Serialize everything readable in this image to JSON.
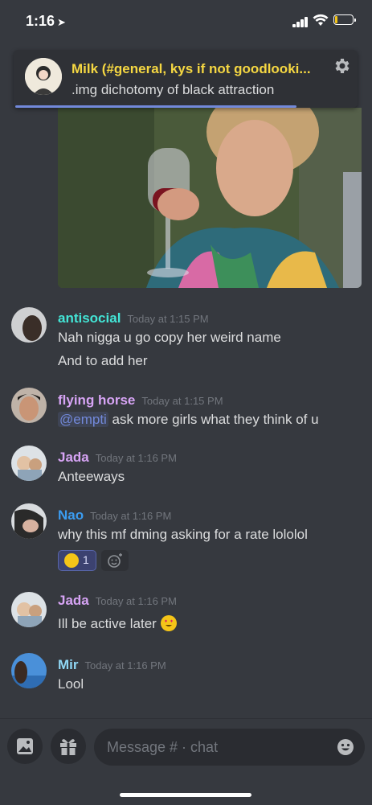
{
  "status_bar": {
    "time": "1:16"
  },
  "notification": {
    "title": "Milk (#general, kys if not goodlooki...",
    "body": ".img dichotomy of black attraction"
  },
  "messages": [
    {
      "author": "antisocial",
      "color": "#43e5d6",
      "time": "Today at 1:15 PM",
      "lines": [
        "Nah nigga u go copy her weird name",
        "And to add her"
      ]
    },
    {
      "author": "flying horse",
      "color": "#d7a4f5",
      "time": "Today at 1:15 PM",
      "mention": "@empti",
      "text": " ask more girls what they think of u"
    },
    {
      "author": "Jada",
      "color": "#d7a4f5",
      "time": "Today at 1:16 PM",
      "lines": [
        "Anteeways"
      ]
    },
    {
      "author": "Nao",
      "color": "#3b9cf0",
      "time": "Today at 1:16 PM",
      "lines": [
        "why this mf dming asking for a rate lololol"
      ],
      "reaction": {
        "emoji": "joy-emoji",
        "count": "1"
      }
    },
    {
      "author": "Jada",
      "color": "#d7a4f5",
      "time": "Today at 1:16 PM",
      "lines": [
        "Ill be active later"
      ],
      "emoji": "heart-eyes-emoji"
    },
    {
      "author": "Mir",
      "color": "#8fd5f2",
      "time": "Today at 1:16 PM",
      "lines": [
        "Lool"
      ]
    }
  ],
  "composer": {
    "placeholder": "Message # · chat"
  },
  "icons": [
    "location-arrow-icon",
    "signal-icon",
    "wifi-icon",
    "battery-icon",
    "gear-icon",
    "image-icon",
    "gift-icon",
    "smile-icon",
    "add-reaction-icon"
  ]
}
